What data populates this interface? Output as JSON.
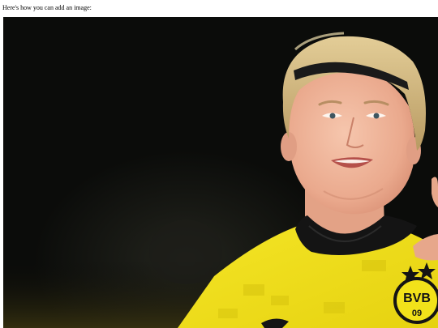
{
  "page": {
    "intro_text": "Here's how you can add an image:"
  },
  "image": {
    "subject": "photo of a smiling footballer with blond hair and a black headband wearing a yellow and black jersey",
    "crest_text": "BVB",
    "crest_number": "09",
    "colors": {
      "background": "#0b0c0a",
      "jersey": "#f2e21a",
      "collar": "#141414",
      "skin": "#f0b59b",
      "hair": "#d8c087",
      "headband": "#1a1a1a"
    }
  }
}
